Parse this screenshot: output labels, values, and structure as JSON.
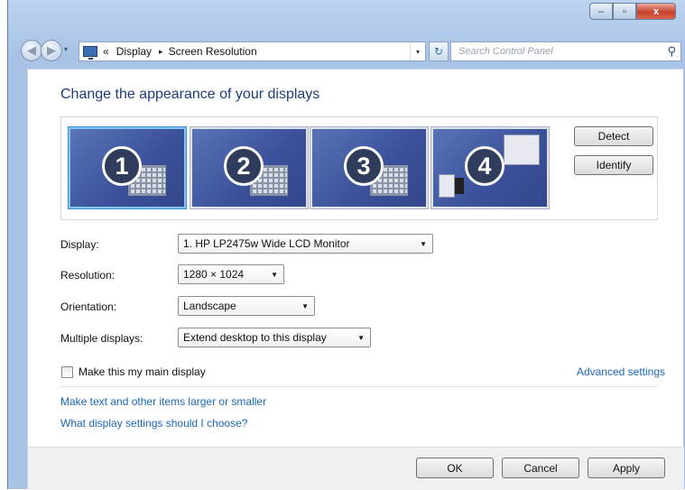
{
  "window": {
    "caption_buttons": {
      "minimize": "–",
      "maximize": "▫",
      "close": "x"
    }
  },
  "nav": {
    "breadcrumb_prefix": "«",
    "breadcrumb": [
      "Display",
      "Screen Resolution"
    ],
    "breadcrumb_separator": "▸",
    "dropdown_arrow": "▾",
    "refresh_glyph": "↻",
    "search_placeholder": "Search Control Panel",
    "search_glyph": "⚲",
    "back_glyph": "◀",
    "forward_glyph": "▶"
  },
  "main": {
    "title": "Change the appearance of your displays",
    "monitors": [
      {
        "number": "1",
        "selected": true
      },
      {
        "number": "2",
        "selected": false
      },
      {
        "number": "3",
        "selected": false
      },
      {
        "number": "4",
        "selected": false
      }
    ],
    "detect_label": "Detect",
    "identify_label": "Identify"
  },
  "fields": {
    "display": {
      "label": "Display:",
      "value": "1. HP LP2475w Wide LCD Monitor"
    },
    "resolution": {
      "label": "Resolution:",
      "value": "1280 × 1024"
    },
    "orientation": {
      "label": "Orientation:",
      "value": "Landscape"
    },
    "multiple": {
      "label": "Multiple displays:",
      "value": "Extend desktop to this display"
    },
    "combo_arrow": "▼"
  },
  "main_display": {
    "label": "Make this my main display",
    "checked": false
  },
  "links": {
    "advanced": "Advanced settings",
    "text_size": "Make text and other items larger or smaller",
    "help": "What display settings should I choose?"
  },
  "footer": {
    "ok": "OK",
    "cancel": "Cancel",
    "apply": "Apply"
  },
  "colors": {
    "accent_title": "#1e3c78",
    "link": "#1a66b8",
    "chrome": "#a9c3e6",
    "monitor_fill": "#3a509a",
    "selected_border": "#7fc7f2"
  }
}
